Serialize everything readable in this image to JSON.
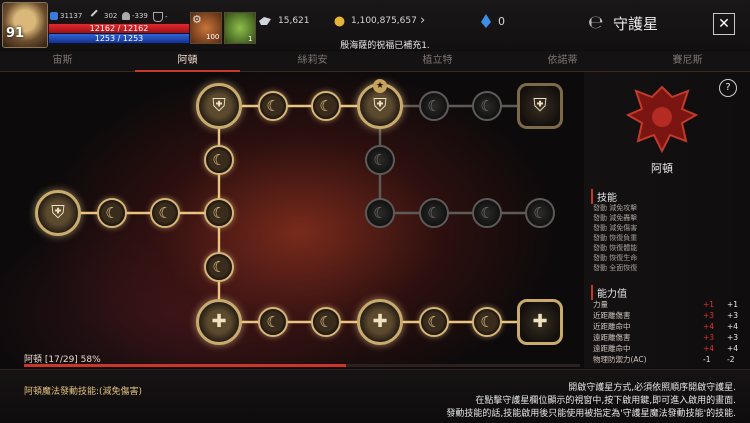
{
  "player": {
    "level": "91",
    "stat_a": "31137",
    "stat_b": "302",
    "stat_c": "-339",
    "stat_d": "-",
    "hp_text": "12162 / 12162",
    "hp_ratio": 1.0,
    "mp_text": "1253 / 1253",
    "mp_ratio": 1.0
  },
  "slots": {
    "slot1_count": "100",
    "slot2_count": "1"
  },
  "currency": {
    "crystal": "15,621",
    "gold": "1,100,875,657",
    "gem": "0"
  },
  "notice": "殷海薩的祝福已補充1.",
  "window": {
    "title": "守護星",
    "close": "✕"
  },
  "tabs": [
    "宙斯",
    "阿頓",
    "絲莉安",
    "植立特",
    "依諾蒂",
    "賽尼斯"
  ],
  "active_tab": 1,
  "progress": {
    "label": "阿頓 [17/29] 58%",
    "ratio": 0.58
  },
  "guardian": {
    "name": "阿頓"
  },
  "skills": {
    "title": "技能",
    "items": [
      "發動 減免攻擊",
      "發動 減免轟擊",
      "發動 減免傷害",
      "發動 恢復負重",
      "發動 恢復體能",
      "發動 恢復生命",
      "發動 全面恢復"
    ]
  },
  "stats": {
    "title": "能力值",
    "rows": [
      {
        "name": "力量",
        "diff": "+1",
        "value": "+1"
      },
      {
        "name": "近距離傷害",
        "diff": "+3",
        "value": "+3"
      },
      {
        "name": "近距離命中",
        "diff": "+4",
        "value": "+4"
      },
      {
        "name": "遠距離傷害",
        "diff": "+3",
        "value": "+3"
      },
      {
        "name": "遠距離命中",
        "diff": "+4",
        "value": "+4"
      },
      {
        "name": "物理防禦力(AC)",
        "diff": "-1",
        "value": "-2"
      }
    ]
  },
  "footer": {
    "left": "阿頓魔法發動技能:(減免傷害)",
    "right1": "開啟守護星方式,必須依照順序開啟守護星.",
    "right2": "在點擊守護星欄位顯示的視窗中,按下啟用鍵,即可進入啟用的畫面.",
    "right3": "發動技能的話,技能啟用後只能使用被指定為'守護星魔法發動技能'的技能."
  },
  "icons": {
    "active_node": "crescent-moon-icon",
    "inactive_node": "crescent-moon-icon",
    "big_node": "shield-emblem-icon",
    "star": "star-icon"
  },
  "colors": {
    "accent_red": "#c9372a",
    "gold": "#e9c47f"
  }
}
